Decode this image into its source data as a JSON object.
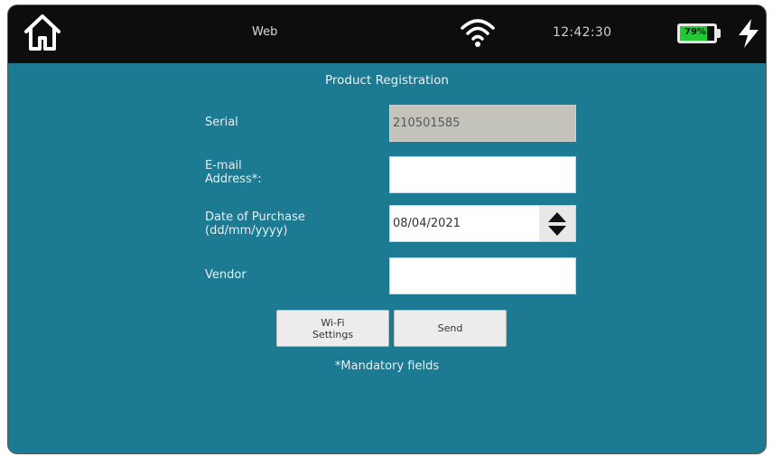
{
  "status_bar": {
    "app_title": "Web",
    "time": "12:42:30",
    "battery_percent": "79%",
    "battery_level": 0.79,
    "icons": [
      "home-icon",
      "wifi-icon",
      "battery-icon",
      "charging-icon"
    ]
  },
  "form": {
    "title": "Product Registration",
    "serial": {
      "label": "Serial",
      "value": "210501585"
    },
    "email": {
      "label_line1": "E-mail",
      "label_line2": "Address*:",
      "value": ""
    },
    "purchase_date": {
      "label_line1": "Date of Purchase",
      "label_line2": "(dd/mm/yyyy)",
      "value": "08/04/2021"
    },
    "vendor": {
      "label": "Vendor",
      "value": ""
    },
    "buttons": {
      "wifi_line1": "Wi-Fi",
      "wifi_line2": "Settings",
      "send": "Send"
    },
    "mandatory_note": "*Mandatory fields"
  },
  "colors": {
    "background": "#1c7a92",
    "status_bar": "#0d0d0d",
    "battery_fill": "#21c934"
  }
}
